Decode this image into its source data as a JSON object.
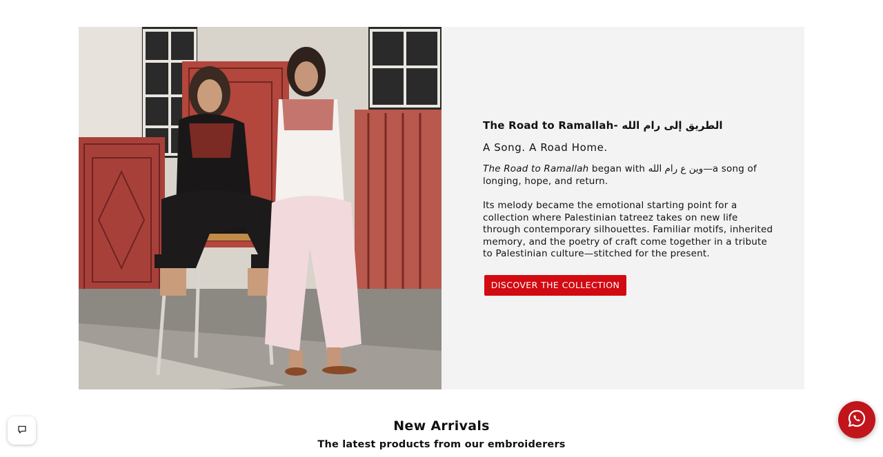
{
  "hero": {
    "image_alt": "Two models wearing tatreez-embroidered outfits in front of hanging embroidered rugs",
    "title": "The Road to Ramallah- الطريق إلى رام الله",
    "subtitle": "A Song. A Road Home.",
    "p1_em": "The Road to Ramallah",
    "p1_rest": " began with وين ع رام الله—a song of longing, hope, and return.",
    "p2": "Its melody became the emotional starting point for a collection where Palestinian tatreez takes on new life through contemporary silhouettes. Familiar motifs, inherited memory, and the poetry of craft come together in a tribute to Palestinian culture—stitched for the present.",
    "cta_label": "DISCOVER THE COLLECTION",
    "content_bg": "#f3f3f3",
    "cta_color": "#d20a11"
  },
  "new_arrivals": {
    "title": "New Arrivals",
    "subtitle": "The latest products from our embroiderers"
  },
  "floating": {
    "chat_icon": "chat-bubble-icon",
    "whatsapp_icon": "whatsapp-icon",
    "whatsapp_color": "#c1151b"
  }
}
